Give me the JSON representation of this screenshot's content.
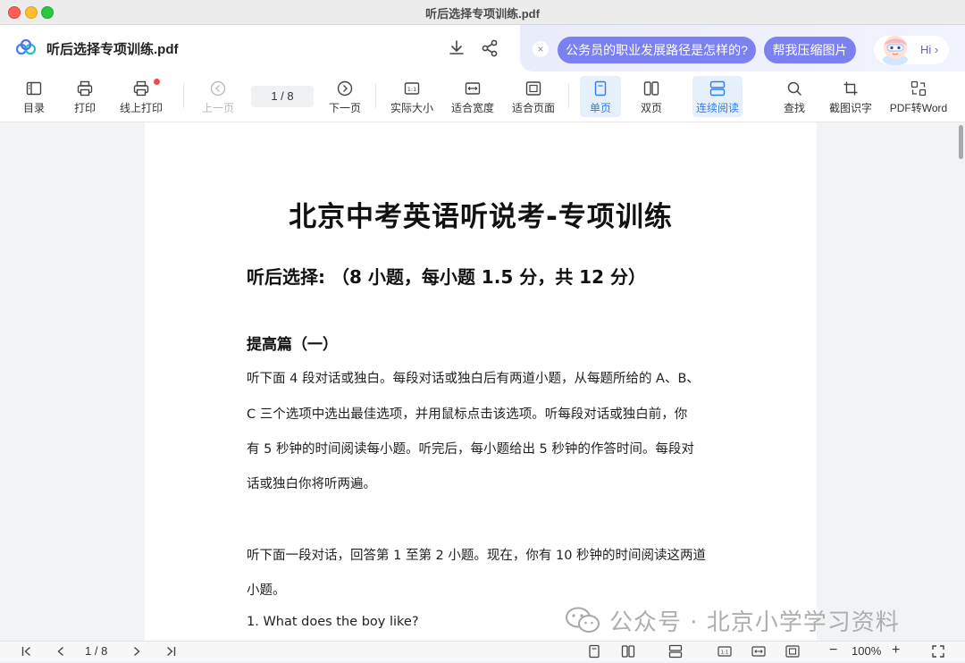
{
  "window": {
    "title": "听后选择专项训练.pdf"
  },
  "header": {
    "file_name": "听后选择专项训练.pdf"
  },
  "ai_panel": {
    "close": "×",
    "suggestion_1": "公务员的职业发展路径是怎样的?",
    "suggestion_2": "帮我压缩图片",
    "hi_label": "Hi ›"
  },
  "toolbar": {
    "toc": "目录",
    "print": "打印",
    "online_print": "线上打印",
    "prev_page": "上一页",
    "page_indicator": "1 / 8",
    "next_page": "下一页",
    "actual_size": "实际大小",
    "fit_width": "适合宽度",
    "fit_page": "适合页面",
    "single_page": "单页",
    "double_page": "双页",
    "continuous": "连续阅读",
    "find": "查找",
    "screenshot_ocr": "截图识字",
    "pdf_to_word": "PDF转Word"
  },
  "document": {
    "title": "北京中考英语听说考-专项训练",
    "subtitle": "听后选择: （8 小题，每小题 1.5 分，共 12 分）",
    "section": "提高篇（一）",
    "lines": [
      "听下面 4 段对话或独白。每段对话或独白后有两道小题，从每题所给的 A、B、",
      "C 三个选项中选出最佳选项，并用鼠标点击该选项。听每段对话或独白前，你",
      "有 5 秒钟的时间阅读每小题。听完后，每小题给出 5 秒钟的作答时间。每段对",
      "话或独白你将听两遍。",
      "听下面一段对话，回答第 1 至第 2 小题。现在，你有 10 秒钟的时间阅读这两道",
      "小题。",
      "1. What does the boy like?"
    ]
  },
  "watermark": {
    "text": "公众号 · 北京小学学习资料"
  },
  "bottom_bar": {
    "page_indicator": "1 / 8",
    "zoom": "100%",
    "zoom_out": "−",
    "zoom_in": "+"
  }
}
